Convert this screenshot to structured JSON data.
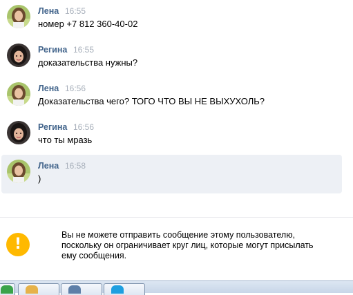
{
  "messages": [
    {
      "author": "Лена",
      "time": "16:55",
      "text": "номер +7 812 360-40-02",
      "avatar": "lena"
    },
    {
      "author": "Регина",
      "time": "16:55",
      "text": "доказательства нужны?",
      "avatar": "regina"
    },
    {
      "author": "Лена",
      "time": "16:56",
      "text": "Доказательства чего? ТОГО ЧТО ВЫ НЕ ВЫХУХОЛЬ?",
      "avatar": "lena"
    },
    {
      "author": "Регина",
      "time": "16:56",
      "text": "что ты мразь",
      "avatar": "regina"
    },
    {
      "author": "Лена",
      "time": "16:58",
      "text": ")",
      "avatar": "lena"
    }
  ],
  "notice": {
    "icon": "exclamation-icon",
    "icon_glyph": "!",
    "lines": [
      "Вы не можете отправить сообщение этому пользователю,",
      "поскольку он ограничивает круг лиц, которые могут присылать",
      "ему сообщения."
    ]
  },
  "colors": {
    "author": "#42648b",
    "time": "#a8b0bb",
    "highlight": "#edf0f5",
    "warning": "#ffb900"
  }
}
